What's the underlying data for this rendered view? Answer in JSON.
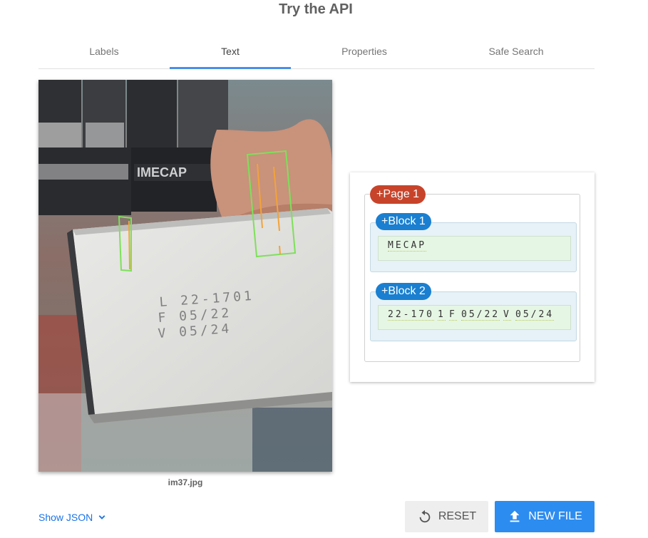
{
  "header": {
    "title": "Try the API"
  },
  "tabs": [
    {
      "label": "Labels",
      "active": false
    },
    {
      "label": "Text",
      "active": true
    },
    {
      "label": "Properties",
      "active": false
    },
    {
      "label": "Safe Search",
      "active": false
    }
  ],
  "image": {
    "filename": "im37.jpg",
    "printed_text": [
      "L 22-1701",
      "F 05/22",
      "V 05/24"
    ],
    "background_text": "IMECAP"
  },
  "result": {
    "page_label": "+Page 1",
    "blocks": [
      {
        "label": "+Block 1",
        "words": [
          "MECAP"
        ]
      },
      {
        "label": "+Block 2",
        "words": [
          "22-170",
          "1",
          "F",
          "05/22",
          "V",
          "05/24"
        ]
      }
    ]
  },
  "footer": {
    "show_json_label": "Show JSON",
    "reset_label": "RESET",
    "new_file_label": "NEW FILE"
  },
  "colors": {
    "accent": "#4a8fe7",
    "page_chip": "#c7442b",
    "block_chip": "#1a7fd0",
    "new_file_button": "#2d8cf0",
    "box_outline_green": "#7ee05a",
    "box_outline_orange": "#f2a33a"
  }
}
